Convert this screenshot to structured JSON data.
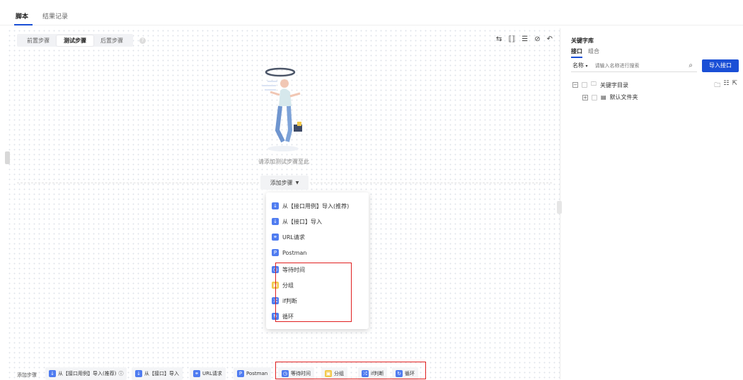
{
  "tabs": {
    "script": "脚本",
    "results": "结果记录"
  },
  "step_tabs": {
    "pre": "前置步骤",
    "test": "测试步骤",
    "post": "后置步骤"
  },
  "empty_text": "请添加测试步骤至此",
  "add_step": "添加步骤",
  "dropdown": {
    "import_case": "从【接口用例】导入(推荐)",
    "import_api": "从【接口】导入",
    "url_request": "URL请求",
    "postman": "Postman",
    "wait_time": "等待时间",
    "group": "分组",
    "if_judge": "if判断",
    "loop": "循环"
  },
  "bottom": {
    "label": "添加步骤",
    "import_case": "从【接口用例】导入(推荐)",
    "import_api": "从【接口】导入",
    "url_request": "URL请求",
    "postman": "Postman",
    "wait_time": "等待时间",
    "group": "分组",
    "if_judge": "if判断",
    "loop": "循环"
  },
  "library": {
    "title": "关键字库",
    "tab_api": "接口",
    "tab_combo": "组合",
    "search_field": "名称",
    "search_placeholder": "请输入名称进行搜索",
    "import_button": "导入接口",
    "root": "关键字目录",
    "default_folder": "默认文件夹"
  },
  "colors": {
    "accent": "#1a4fd6",
    "highlight": "#e02020"
  }
}
